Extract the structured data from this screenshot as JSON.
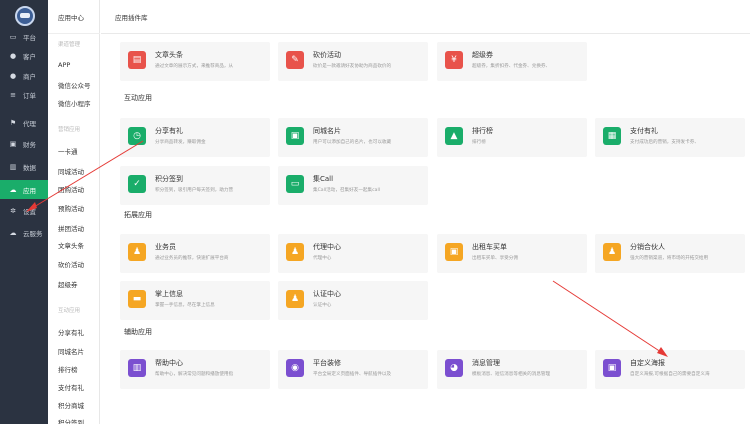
{
  "sidebar": {
    "items": [
      {
        "label": "平台",
        "icon": "monitor-icon",
        "glyph": "▭"
      },
      {
        "label": "客户",
        "icon": "user-icon",
        "glyph": "●"
      },
      {
        "label": "商户",
        "icon": "users-icon",
        "glyph": "●"
      },
      {
        "label": "订单",
        "icon": "list-icon",
        "glyph": "≡"
      },
      {
        "label": "代理",
        "icon": "flag-icon",
        "glyph": "⚑"
      },
      {
        "label": "财务",
        "icon": "wallet-icon",
        "glyph": "▣"
      },
      {
        "label": "数据",
        "icon": "chart-icon",
        "glyph": "▥"
      },
      {
        "label": "应用",
        "icon": "cloud-app-icon",
        "glyph": "☁"
      },
      {
        "label": "设置",
        "icon": "gear-icon",
        "glyph": "✲"
      },
      {
        "label": "云服务",
        "icon": "cloud-icon",
        "glyph": "☁"
      }
    ],
    "active_index": 7,
    "active_color": "#1aad6a"
  },
  "subnav": {
    "title": "应用中心",
    "items": [
      {
        "label": "渠道管理",
        "grey": true
      },
      {
        "label": "APP"
      },
      {
        "label": "微信公众号"
      },
      {
        "label": "微信小程序"
      },
      {
        "label": "营销应用",
        "grey": true
      },
      {
        "label": "一卡通"
      },
      {
        "label": "同城活动"
      },
      {
        "label": "团购活动"
      },
      {
        "label": "预购活动"
      },
      {
        "label": "拼团活动"
      },
      {
        "label": "文章头条"
      },
      {
        "label": "砍价活动"
      },
      {
        "label": "超级券"
      },
      {
        "label": "互动应用",
        "grey": true
      },
      {
        "label": "分享有礼"
      },
      {
        "label": "同城名片"
      },
      {
        "label": "排行榜"
      },
      {
        "label": "支付有礼"
      },
      {
        "label": "积分商城"
      },
      {
        "label": "积分签到"
      }
    ]
  },
  "header": {
    "title": "应用插件库"
  },
  "sections": [
    {
      "cards": [
        {
          "title": "文章头条",
          "desc": "通过文章的展示方式，来推荐商品，从",
          "color": "#e8534b",
          "icon": "article-icon",
          "glyph": "▤"
        },
        {
          "title": "砍价活动",
          "desc": "砍价是一款邀请好友协助为商品砍价的",
          "color": "#e8534b",
          "icon": "bargain-icon",
          "glyph": "✎"
        },
        {
          "title": "超级券",
          "desc": "超级券，集折扣券、代金券、兑换券、",
          "color": "#e8534b",
          "icon": "coupon-icon",
          "glyph": "¥"
        }
      ]
    },
    {
      "title": "互动应用",
      "cards": [
        {
          "title": "分享有礼",
          "desc": "分享商品转发，赚取佣金",
          "color": "#1aad6a",
          "icon": "share-gift-icon",
          "glyph": "◷"
        },
        {
          "title": "同城名片",
          "desc": "用户可以添加自己的名片，也可以收藏",
          "color": "#1aad6a",
          "icon": "card-icon",
          "glyph": "▣"
        },
        {
          "title": "排行榜",
          "desc": "排行榜",
          "color": "#1aad6a",
          "icon": "rank-icon",
          "glyph": "▲"
        },
        {
          "title": "支付有礼",
          "desc": "支付成功后的营销，支持发卡券、",
          "color": "#1aad6a",
          "icon": "gift-icon",
          "glyph": "▦"
        },
        {
          "title": "积分签到",
          "desc": "积分签到，吸引用户每天签到，助力营",
          "color": "#1aad6a",
          "icon": "checkin-icon",
          "glyph": "✓"
        },
        {
          "title": "集Call",
          "desc": "集Call活动，召集好友一起集call",
          "color": "#1aad6a",
          "icon": "call-icon",
          "glyph": "▭"
        }
      ]
    },
    {
      "title": "拓展应用",
      "cards": [
        {
          "title": "业务员",
          "desc": "通过业务员的推荐，快速扩展平台商",
          "color": "#f5a623",
          "icon": "salesman-icon",
          "glyph": "♟"
        },
        {
          "title": "代理中心",
          "desc": "代理中心",
          "color": "#f5a623",
          "icon": "agent-icon",
          "glyph": "♟"
        },
        {
          "title": "出租车买单",
          "desc": "出租车买单、享受分佣",
          "color": "#f5a623",
          "icon": "taxi-icon",
          "glyph": "▣"
        },
        {
          "title": "分销合伙人",
          "desc": "强大的营销渠道，将市场的开拓交给用",
          "color": "#f5a623",
          "icon": "partner-icon",
          "glyph": "♟"
        },
        {
          "title": "掌上信息",
          "desc": "掌握一手信息，尽在掌上信息",
          "color": "#f5a623",
          "icon": "message-icon",
          "glyph": "▬"
        },
        {
          "title": "认证中心",
          "desc": "认证中心",
          "color": "#f5a623",
          "icon": "certify-icon",
          "glyph": "♟"
        }
      ]
    },
    {
      "title": "辅助应用",
      "cards": [
        {
          "title": "帮助中心",
          "desc": "帮助中心，解决常见问题和播放使用指",
          "color": "#7b4fd0",
          "icon": "book-icon",
          "glyph": "▥"
        },
        {
          "title": "平台装修",
          "desc": "平台全局定义页面插件、导航插件以及",
          "color": "#7b4fd0",
          "icon": "palette-icon",
          "glyph": "◉"
        },
        {
          "title": "消息管理",
          "desc": "模板消息、短信消息等相关的消息管理",
          "color": "#7b4fd0",
          "icon": "chat-icon",
          "glyph": "◕"
        },
        {
          "title": "自定义海报",
          "desc": "自定义海报,可根据自己的需要自定义海",
          "color": "#7b4fd0",
          "icon": "poster-icon",
          "glyph": "▣"
        }
      ]
    }
  ],
  "annotation_color": "#e53935"
}
